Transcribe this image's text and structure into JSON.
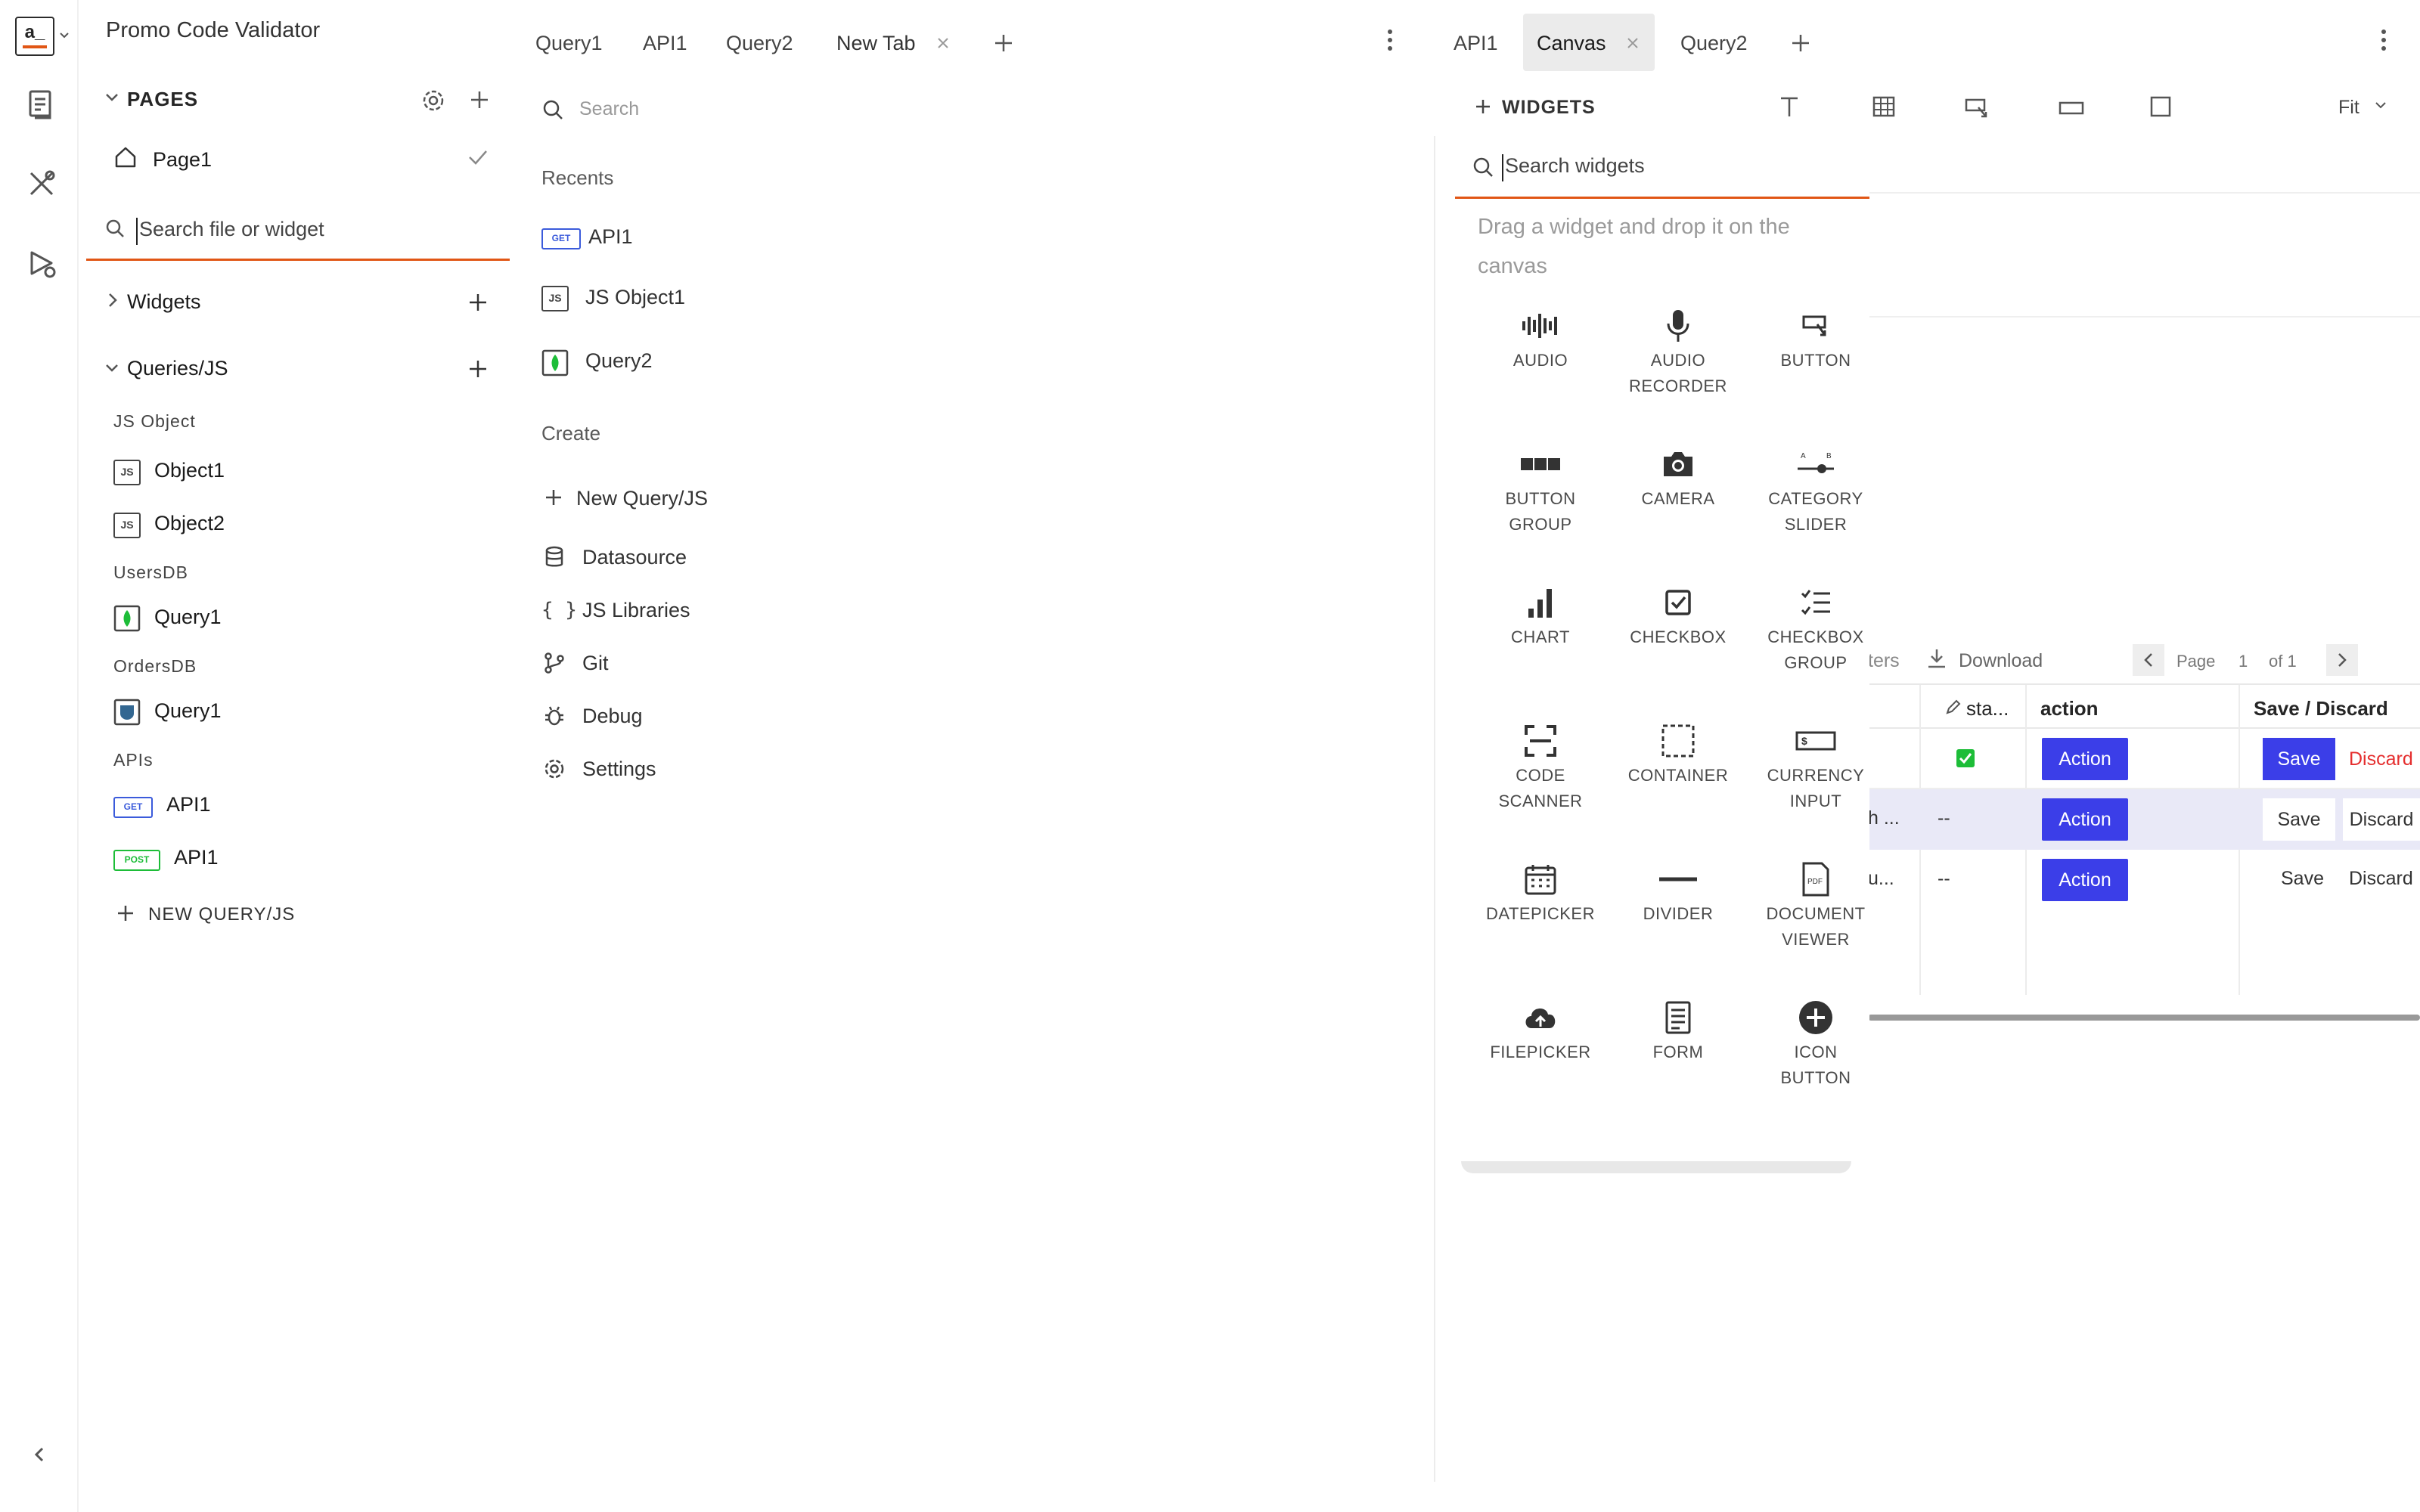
{
  "app": {
    "logo_text": "a_",
    "title": "Promo Code Validator"
  },
  "explorer": {
    "pages_label": "PAGES",
    "page1": "Page1",
    "search_placeholder": "Search file or widget",
    "widgets_label": "Widgets",
    "queries_label": "Queries/JS",
    "groups": {
      "js_object": "JS Object",
      "users_db": "UsersDB",
      "orders_db": "OrdersDB",
      "apis": "APIs"
    },
    "items": {
      "object1": "Object1",
      "object2": "Object2",
      "users_query1": "Query1",
      "orders_query1": "Query1",
      "api_get": "API1",
      "api_post": "API1"
    },
    "badges": {
      "js": "JS",
      "get": "GET",
      "post": "POST"
    },
    "new_query": "NEW QUERY/JS"
  },
  "editor_tabs": [
    "Query1",
    "API1",
    "Query2",
    "New Tab"
  ],
  "query_panel": {
    "search_placeholder": "Search",
    "recents_label": "Recents",
    "recents": [
      "API1",
      "JS Object1",
      "Query2"
    ],
    "create_label": "Create",
    "create_items": [
      "New Query/JS",
      "Datasource",
      "JS Libraries",
      "Git",
      "Debug",
      "Settings"
    ]
  },
  "canvas_tabs": [
    "API1",
    "Canvas",
    "Query2"
  ],
  "canvas_toolbar": {
    "widgets_label": "WIDGETS",
    "fit_label": "Fit"
  },
  "widgets_panel": {
    "search_placeholder": "Search widgets",
    "hint": "Drag a widget and drop it on the canvas",
    "widgets": [
      [
        "AUDIO"
      ],
      [
        "AUDIO",
        "RECORDER"
      ],
      [
        "BUTTON"
      ],
      [
        "BUTTON",
        "GROUP"
      ],
      [
        "CAMERA"
      ],
      [
        "CATEGORY",
        "SLIDER"
      ],
      [
        "CHART"
      ],
      [
        "CHECKBOX"
      ],
      [
        "CHECKBOX",
        "GROUP"
      ],
      [
        "CODE",
        "SCANNER"
      ],
      [
        "CONTAINER"
      ],
      [
        "CURRENCY",
        "INPUT"
      ],
      [
        "DATEPICKER"
      ],
      [
        "DIVIDER"
      ],
      [
        "DOCUMENT",
        "VIEWER"
      ],
      [
        "FILEPICKER"
      ],
      [
        "FORM"
      ],
      [
        "ICON",
        "BUTTON"
      ]
    ]
  },
  "table": {
    "filters_fragment": "ters",
    "download_label": "Download",
    "page_label": "Page",
    "page_value": "1",
    "page_of": "of 1",
    "headers": {
      "status": "sta...",
      "action": "action",
      "save_discard": "Save / Discard"
    },
    "rows": [
      {
        "name_fragment": "",
        "status": "",
        "action": "Action",
        "save": "Save",
        "discard": "Discard"
      },
      {
        "name_fragment": "h ...",
        "status": "--",
        "action": "Action",
        "save": "Save",
        "discard": "Discard"
      },
      {
        "name_fragment": "u...",
        "status": "--",
        "action": "Action",
        "save": "Save",
        "discard": "Discard"
      }
    ]
  },
  "colors": {
    "accent": "#e15615",
    "primary": "#3b3ee8",
    "danger": "#e52e2e",
    "success": "#1dbd38"
  }
}
